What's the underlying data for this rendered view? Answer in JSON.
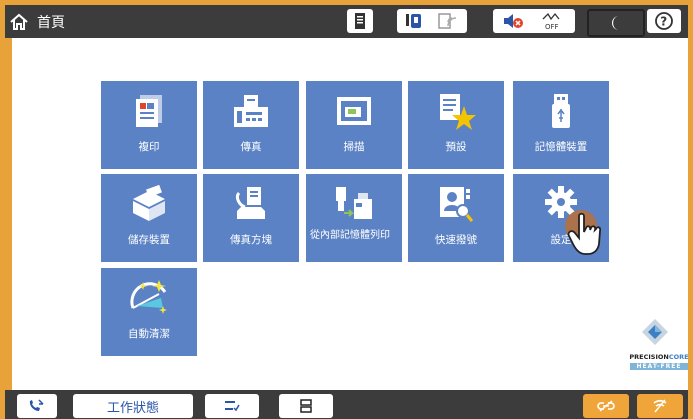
{
  "header": {
    "title": "首頁"
  },
  "status_icons": [
    "document-status-icon",
    "ink-status-icon",
    "wifi-icon",
    "mute-icon",
    "power-off-icon",
    "sleep-icon",
    "help-icon"
  ],
  "tiles": [
    {
      "label": "複印",
      "icon": "copy-icon"
    },
    {
      "label": "傳真",
      "icon": "fax-icon"
    },
    {
      "label": "掃描",
      "icon": "scan-icon"
    },
    {
      "label": "預設",
      "icon": "preset-icon"
    },
    {
      "label": "記憶體裝置",
      "icon": "usb-icon"
    },
    {
      "label": "儲存裝置",
      "icon": "storage-icon"
    },
    {
      "label": "傳真方塊",
      "icon": "fax-box-icon"
    },
    {
      "label": "從內部記憶體列印",
      "icon": "print-memory-icon"
    },
    {
      "label": "快速撥號",
      "icon": "speed-dial-icon"
    },
    {
      "label": "設定",
      "icon": "gear-icon"
    },
    {
      "label": "自動清潔",
      "icon": "auto-clean-icon"
    }
  ],
  "bottom": {
    "job_status": "工作狀態"
  },
  "brand": {
    "line1": "PRECISION",
    "line1b": "CORE",
    "line2": "HEAT-FREE"
  },
  "colors": {
    "tile": "#5b82c4",
    "accent": "#e8a23a",
    "bar": "#3c3c3c"
  }
}
